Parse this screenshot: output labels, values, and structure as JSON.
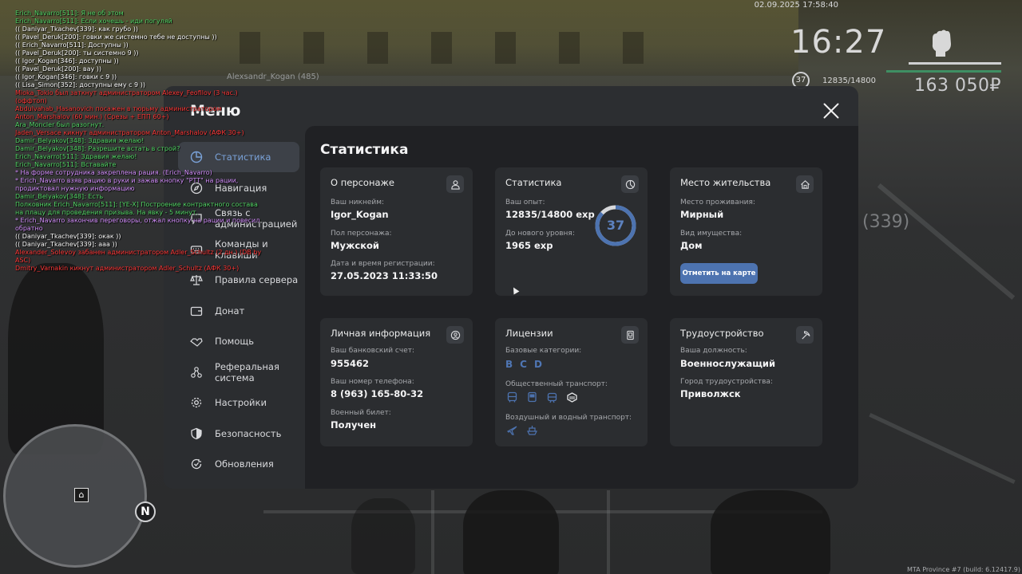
{
  "hud": {
    "date": "02.09.2025 17:58:40",
    "time": "16:27",
    "level": "37",
    "exp": "12835/14800",
    "money": "163 050₽",
    "player_tag": "Alexsandr_Kogan (485)",
    "world_tag": "(339)",
    "minimap_north": "N",
    "build": "MTA Province #7 (build: 6.12417.9)",
    "colors": {
      "hud_green": "#3f8f63",
      "hud_white": "#d8d8d8"
    }
  },
  "chat": [
    {
      "text": "Erich_Navarro[511]: Я не об этом",
      "color": "#57d96a"
    },
    {
      "text": "Erich_Navarro[511]: Если хочешь - иди погуляй",
      "color": "#57d96a"
    },
    {
      "text": "(( Daniyar_Tkachev[339]: как грубо ))",
      "color": "#ffffff"
    },
    {
      "text": "(( Pavel_Deruk[200]: говки же системно тебе не доступны ))",
      "color": "#ffffff"
    },
    {
      "text": "(( Erich_Navarro[511]: Доступны ))",
      "color": "#ffffff"
    },
    {
      "text": "(( Pavel_Deruk[200]: ты системно 9 ))",
      "color": "#ffffff"
    },
    {
      "text": "(( Igor_Kogan[346]: доступны ))",
      "color": "#ffffff"
    },
    {
      "text": "(( Pavel_Deruk[200]: вау ))",
      "color": "#ffffff"
    },
    {
      "text": "(( Igor_Kogan[346]: говки с 9 ))",
      "color": "#ffffff"
    },
    {
      "text": "(( Lisa_Simon[352]: доступны ему с 9 ))",
      "color": "#ffffff"
    },
    {
      "text": "Mioka_Tokio был заткнут администратором Alexey_Feofilov (3 час.) (оффтоп)",
      "color": "#ff3b3b"
    },
    {
      "text": "Abdulvahab_Hasanovich посажен в тюрьму администратором Anton_Marshalov (60 мин.) (Срезы + ЕПП 60+)",
      "color": "#ff3b3b"
    },
    {
      "text": "Ara_Moncler был разогнут.",
      "color": "#57d96a"
    },
    {
      "text": "Jaden_Versace кикнут администратором Anton_Marshalov (АФК 30+)",
      "color": "#ff3b3b"
    },
    {
      "text": "Damir_Belyakov[348]: Здравия желаю!",
      "color": "#57d96a"
    },
    {
      "text": "Damir_Belyakov[348]: Разрешите встать в строй?",
      "color": "#57d96a"
    },
    {
      "text": "Erich_Navarro[511]: Здравия желаю!",
      "color": "#57d96a"
    },
    {
      "text": "Erich_Navarro[511]: Вставайте",
      "color": "#57d96a"
    },
    {
      "text": "* На форме сотрудника закреплена рация. (Erich_Navarro)",
      "color": "#d692ff"
    },
    {
      "text": "* Erich_Navarro взяв рацию в руки и зажав кнопку \"PTT\" на рации, продиктовал нужную информацию",
      "color": "#d692ff"
    },
    {
      "text": "Damir_Belyakov[348]: Есть",
      "color": "#57d96a"
    },
    {
      "text": "Полковник Erich_Navarro[511]: [YE-X] Построение контрактного состава на плацу для проведения призыва. На явку - 5 минут.",
      "color": "#57d96a"
    },
    {
      "text": "* Erich_Navarro закончив переговоры, отжал кнопку на рации и повесил обратно",
      "color": "#d692ff"
    },
    {
      "text": "(( Daniyar_Tkachev[339]: окак ))",
      "color": "#ffffff"
    },
    {
      "text": "(( Daniyar_Tkachev[339]: ааа ))",
      "color": "#ffffff"
    },
    {
      "text": "Alexander_Solevoy забанен администратором Adler_Schultz (2 дн.) (DB by ASC)",
      "color": "#ff3b3b"
    },
    {
      "text": "Dmitry_Varnakin кикнут администратором Adler_Schultz (АФК 30+)",
      "color": "#ff3b3b"
    }
  ],
  "menu": {
    "title": "Меню",
    "nav": [
      {
        "id": "stats",
        "label": "Статистика",
        "icon": "pie-chart-icon",
        "active": true
      },
      {
        "id": "navigation",
        "label": "Навигация",
        "icon": "compass-icon",
        "active": false
      },
      {
        "id": "admin",
        "label": "Связь с администрацией",
        "icon": "chat-icon",
        "active": false
      },
      {
        "id": "commands",
        "label": "Команды и клавиши",
        "icon": "keyboard-icon",
        "active": false
      },
      {
        "id": "rules",
        "label": "Правила сервера",
        "icon": "scales-icon",
        "active": false
      },
      {
        "id": "donate",
        "label": "Донат",
        "icon": "wallet-icon",
        "active": false
      },
      {
        "id": "help",
        "label": "Помощь",
        "icon": "handshake-icon",
        "active": false
      },
      {
        "id": "referral",
        "label": "Реферальная система",
        "icon": "network-icon",
        "active": false
      },
      {
        "id": "settings",
        "label": "Настройки",
        "icon": "gear-icon",
        "active": false
      },
      {
        "id": "security",
        "label": "Безопасность",
        "icon": "shield-icon",
        "active": false
      },
      {
        "id": "updates",
        "label": "Обновления",
        "icon": "refresh-check-icon",
        "active": false
      }
    ]
  },
  "content": {
    "title": "Статистика",
    "character": {
      "title": "О персонаже",
      "icon": "user-icon",
      "nickname_label": "Ваш никнейм:",
      "nickname": "Igor_Kogan",
      "gender_label": "Пол персонажа:",
      "gender": "Мужской",
      "reg_label": "Дата и время регистрации:",
      "reg": "27.05.2023 11:33:50"
    },
    "stats": {
      "title": "Статистика",
      "icon": "chart-icon",
      "exp_label": "Ваш опыт:",
      "exp": "12835/14800 exp",
      "next_label": "До нового уровня:",
      "next": "1965 exp",
      "level": "37",
      "level_progress": 0.867
    },
    "residence": {
      "title": "Место жительства",
      "icon": "home-icon",
      "place_label": "Место проживания:",
      "place": "Мирный",
      "property_label": "Вид имущества:",
      "property": "Дом",
      "button": "Отметить на карте"
    },
    "personal": {
      "title": "Личная информация",
      "icon": "face-icon",
      "bank_label": "Ваш банковский счет:",
      "bank": "955462",
      "phone_label": "Ваш номер телефона:",
      "phone": "8 (963) 165-80-32",
      "military_label": "Военный билет:",
      "military": "Получен"
    },
    "licenses": {
      "title": "Лицензии",
      "icon": "id-card-icon",
      "base_label": "Базовые категории:",
      "base": [
        "B",
        "C",
        "D"
      ],
      "public_label": "Общественный транспорт:",
      "public_icons": [
        "bus-icon",
        "bus-front-icon",
        "tram-icon",
        "taxi-badge-icon"
      ],
      "air_label": "Воздушный и водный транспорт:",
      "air_icons": [
        "plane-icon",
        "boat-icon"
      ]
    },
    "job": {
      "title": "Трудоустройство",
      "icon": "pickaxe-icon",
      "position_label": "Ваша должность:",
      "position": "Военнослужащий",
      "city_label": "Город трудоустройства:",
      "city": "Приволжск"
    },
    "colors": {
      "accent": "#4d73b0",
      "active_nav": "#7aa2d8",
      "card": "#2b2d30",
      "content": "#202124"
    }
  }
}
